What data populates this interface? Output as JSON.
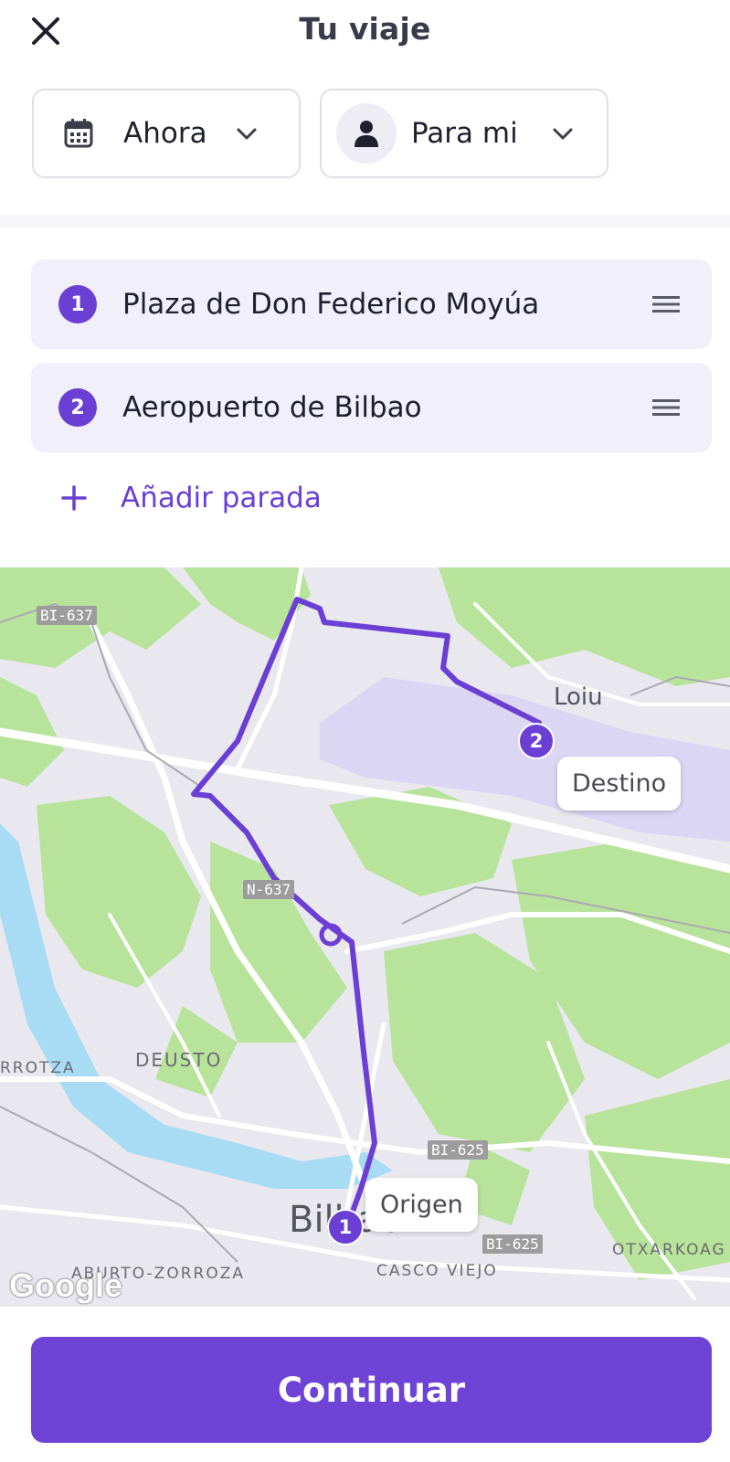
{
  "header": {
    "title": "Tu viaje",
    "when_label": "Ahora",
    "who_label": "Para mi"
  },
  "stops": [
    {
      "number": "1",
      "label": "Plaza de Don Federico Moyúa"
    },
    {
      "number": "2",
      "label": "Aeropuerto de Bilbao"
    }
  ],
  "add_stop_label": "Añadir parada",
  "map": {
    "road_labels": [
      "BI-637",
      "N-637",
      "BI-625",
      "BI-625"
    ],
    "places": [
      "Loiu",
      "DEUSTO",
      "RROTZA",
      "Bilbao",
      "CASCO VIEJO",
      "OTXARKOAG",
      "ABURTO-ZORROZA"
    ],
    "origin_label": "Origen",
    "destination_label": "Destino",
    "origin_marker": "1",
    "destination_marker": "2",
    "attribution": "Google",
    "colors": {
      "route": "#6c3fd4",
      "park": "#b8e39a",
      "water": "#a8dcf5",
      "airport": "#dcd6f5"
    }
  },
  "footer": {
    "continue_label": "Continuar"
  },
  "colors": {
    "accent": "#6c3fd4",
    "stop_bg": "#f0effa"
  },
  "icons": [
    "close-icon",
    "calendar-icon",
    "chevron-down-icon",
    "person-icon",
    "drag-handle-icon",
    "plus-icon"
  ]
}
